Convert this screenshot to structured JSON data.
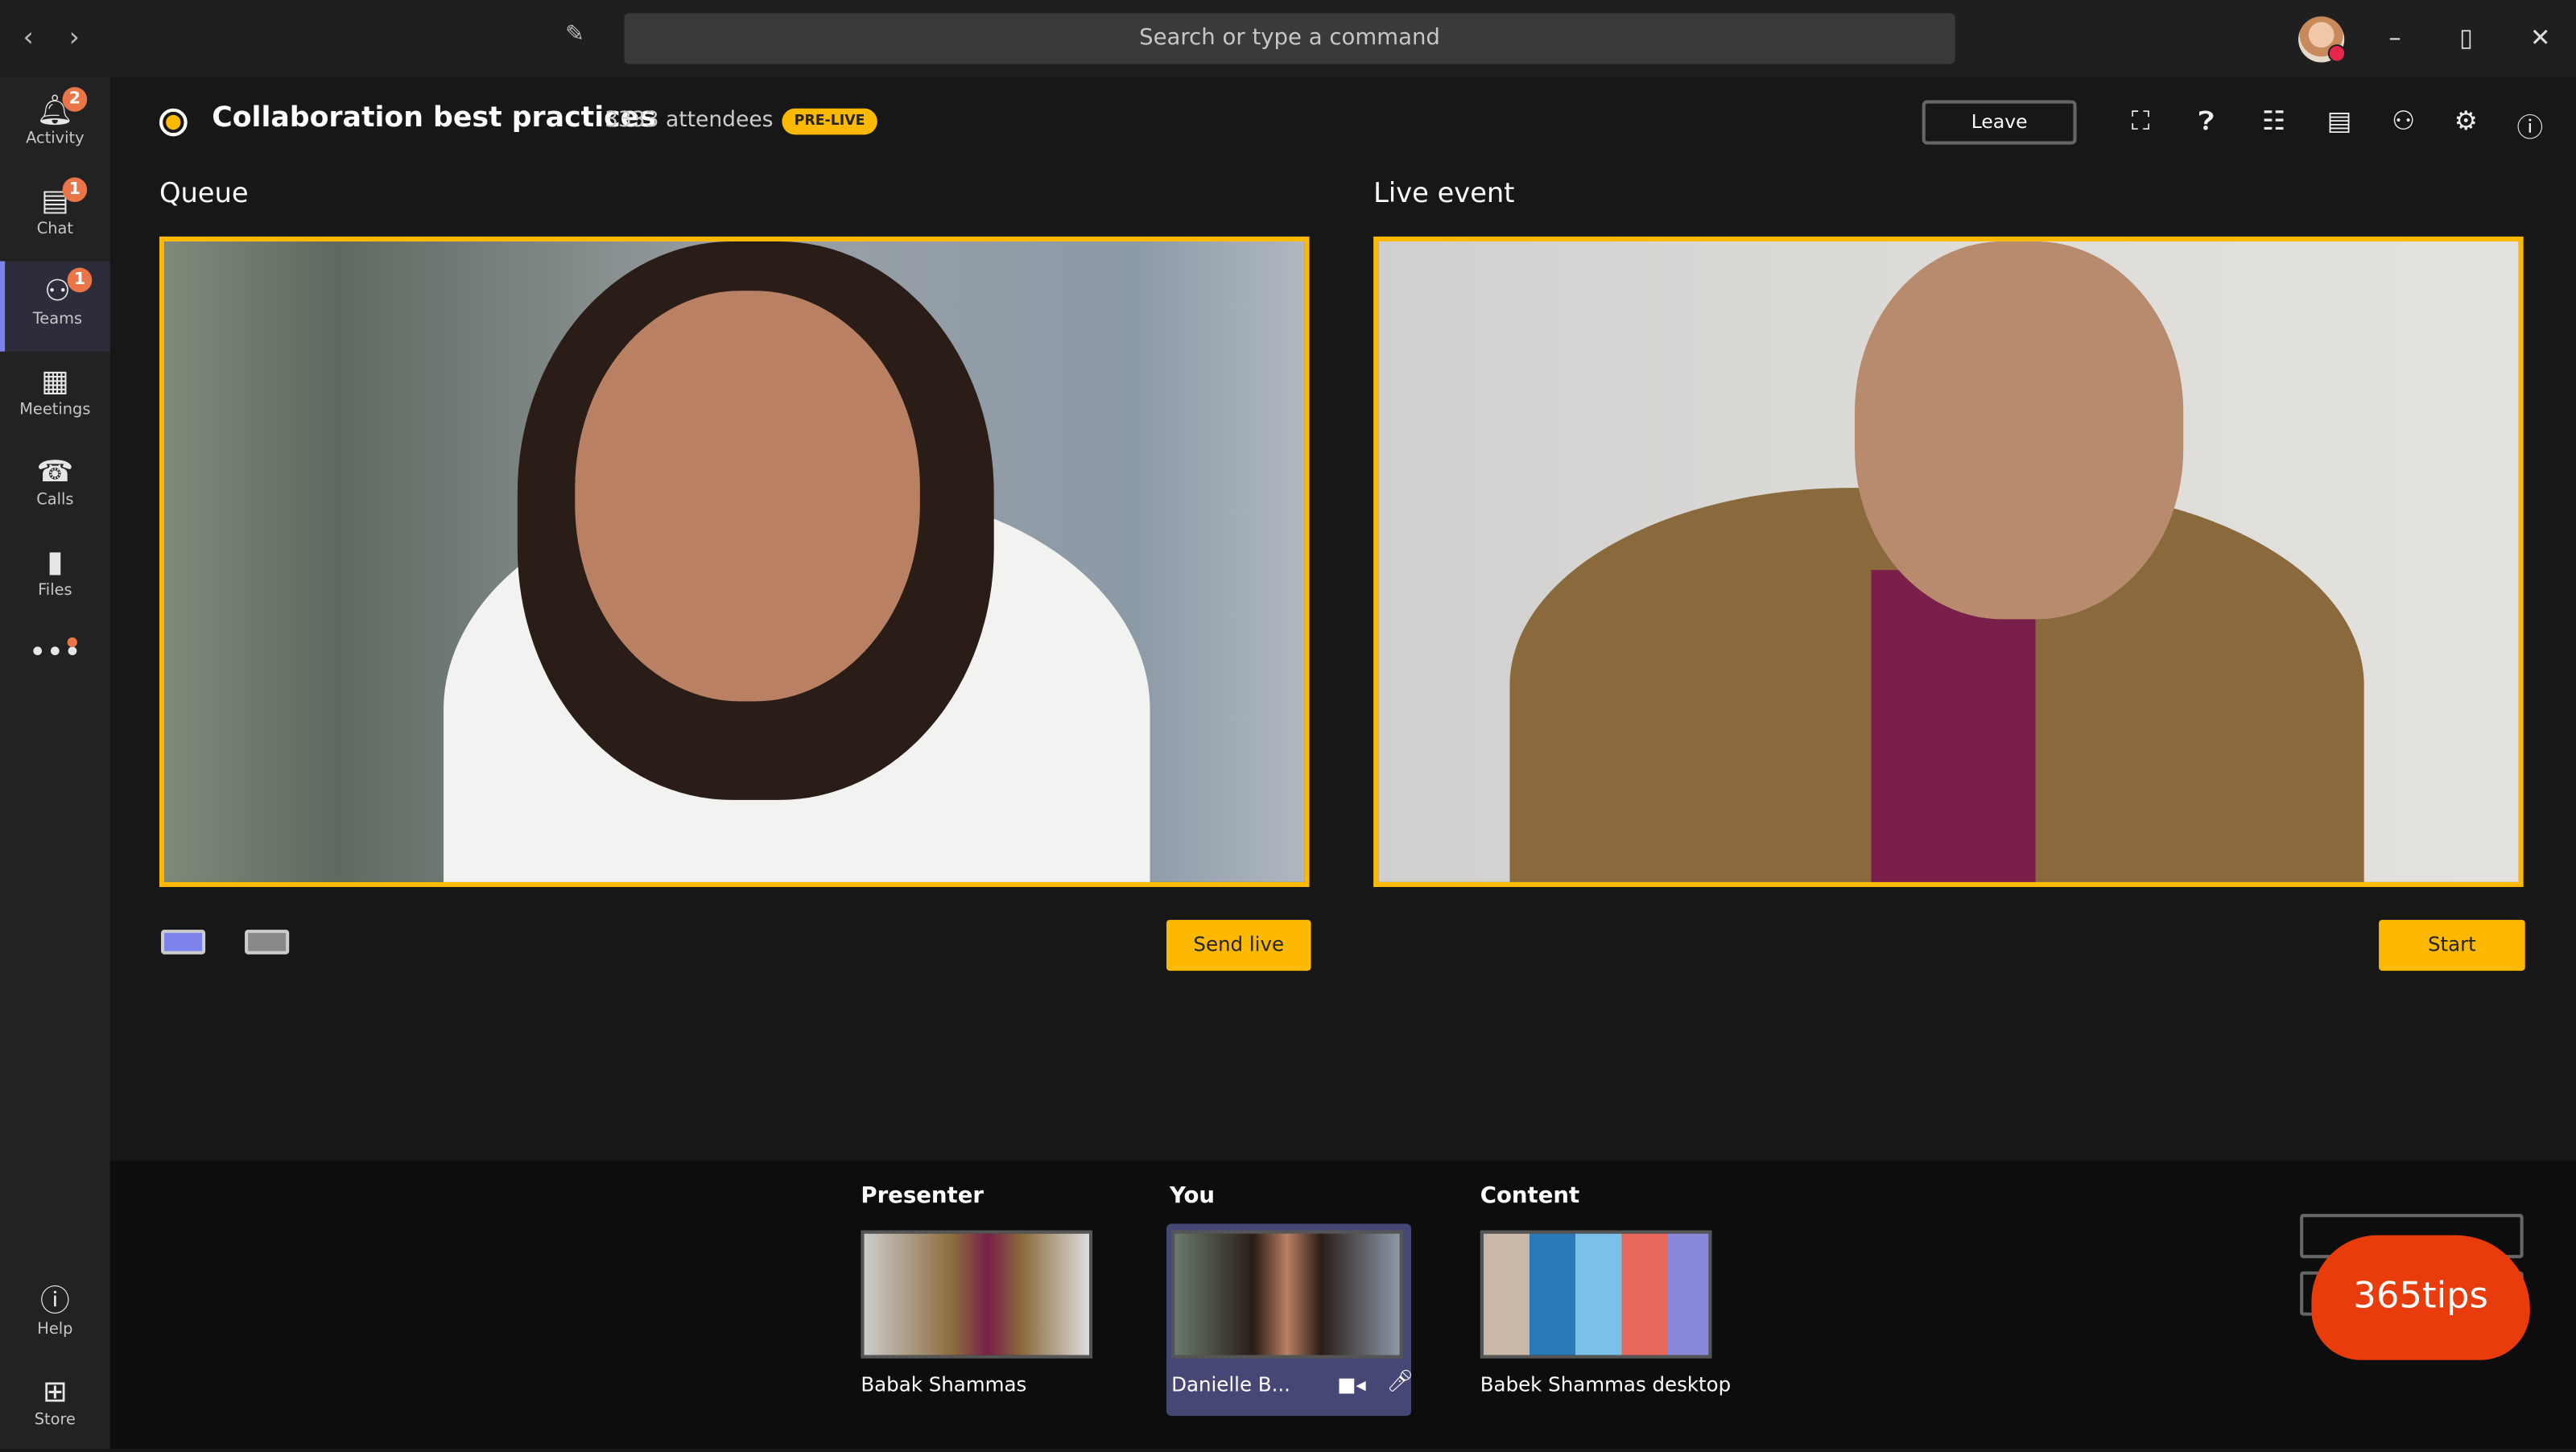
{
  "titlebar": {
    "search_placeholder": "Search or type a command",
    "back_icon": "chevron-left",
    "forward_icon": "chevron-right",
    "compose_icon": "compose"
  },
  "sidebar": {
    "items": [
      {
        "label": "Activity",
        "icon": "bell",
        "badge": "2"
      },
      {
        "label": "Chat",
        "icon": "chat",
        "badge": "1"
      },
      {
        "label": "Teams",
        "icon": "teams",
        "badge": "1",
        "active": true
      },
      {
        "label": "Meetings",
        "icon": "calendar"
      },
      {
        "label": "Calls",
        "icon": "phone"
      },
      {
        "label": "Files",
        "icon": "file"
      },
      {
        "label": "",
        "icon": "more"
      }
    ],
    "bottom": [
      {
        "label": "Help",
        "icon": "help"
      },
      {
        "label": "Store",
        "icon": "store"
      }
    ]
  },
  "event": {
    "title": "Collaboration best practices",
    "attendees": "3333 attendees",
    "status": "PRE-LIVE",
    "leave_label": "Leave"
  },
  "toolbar_icons": [
    "fullscreen",
    "q-and-a",
    "notes",
    "chat",
    "add-people",
    "settings",
    "info"
  ],
  "queue": {
    "label": "Queue",
    "send_live_label": "Send live"
  },
  "live": {
    "label": "Live event",
    "start_label": "Start"
  },
  "sources": {
    "presenter": {
      "label": "Presenter",
      "name": "Babak Shammas"
    },
    "you": {
      "label": "You",
      "name": "Danielle B..."
    },
    "content": {
      "label": "Content",
      "name": "Babek Shammas desktop"
    }
  },
  "watermark": "365tips",
  "colors": {
    "accent": "#fcb900",
    "brand": "#464775",
    "badge": "#e97548",
    "watermark": "#e83c0c"
  }
}
